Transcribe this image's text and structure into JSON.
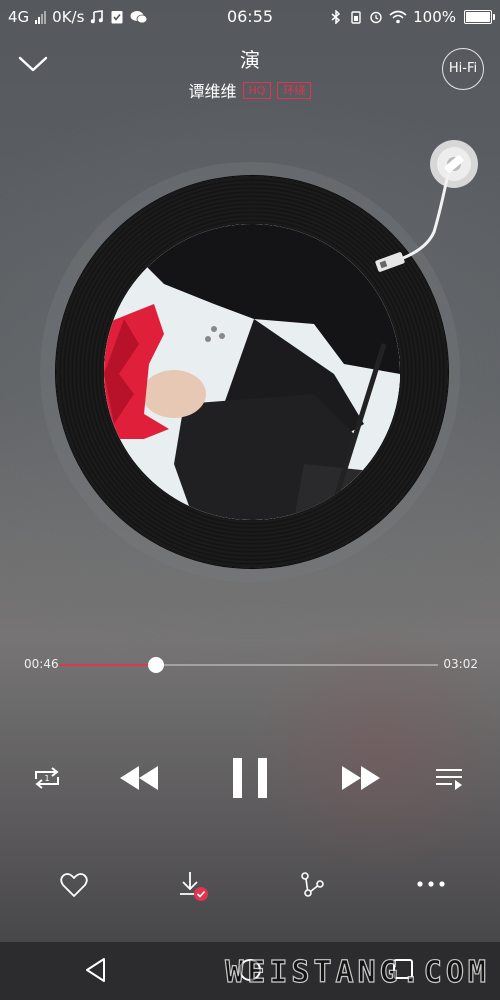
{
  "status_bar": {
    "network": "4G",
    "speed": "0K/s",
    "time": "06:55",
    "battery": "100%"
  },
  "header": {
    "song_title": "演",
    "artist": "谭维维",
    "tags": [
      "HQ",
      "环绕"
    ],
    "hifi_label": "Hi-Fi"
  },
  "progress": {
    "elapsed": "00:46",
    "duration": "03:02",
    "fraction": 0.253
  },
  "watermark": "WEISTANG.COM",
  "colors": {
    "accent": "#e0354e"
  },
  "icons": {
    "collapse": "chevron-down-icon",
    "repeat": "repeat-one-icon",
    "previous": "rewind-icon",
    "play_state": "pause-icon",
    "next": "fast-forward-icon",
    "playlist": "playlist-icon",
    "like": "heart-icon",
    "download": "downloaded-icon",
    "share": "share-icon",
    "more": "more-icon",
    "back": "back-icon",
    "home": "home-icon",
    "recents": "recents-icon"
  }
}
